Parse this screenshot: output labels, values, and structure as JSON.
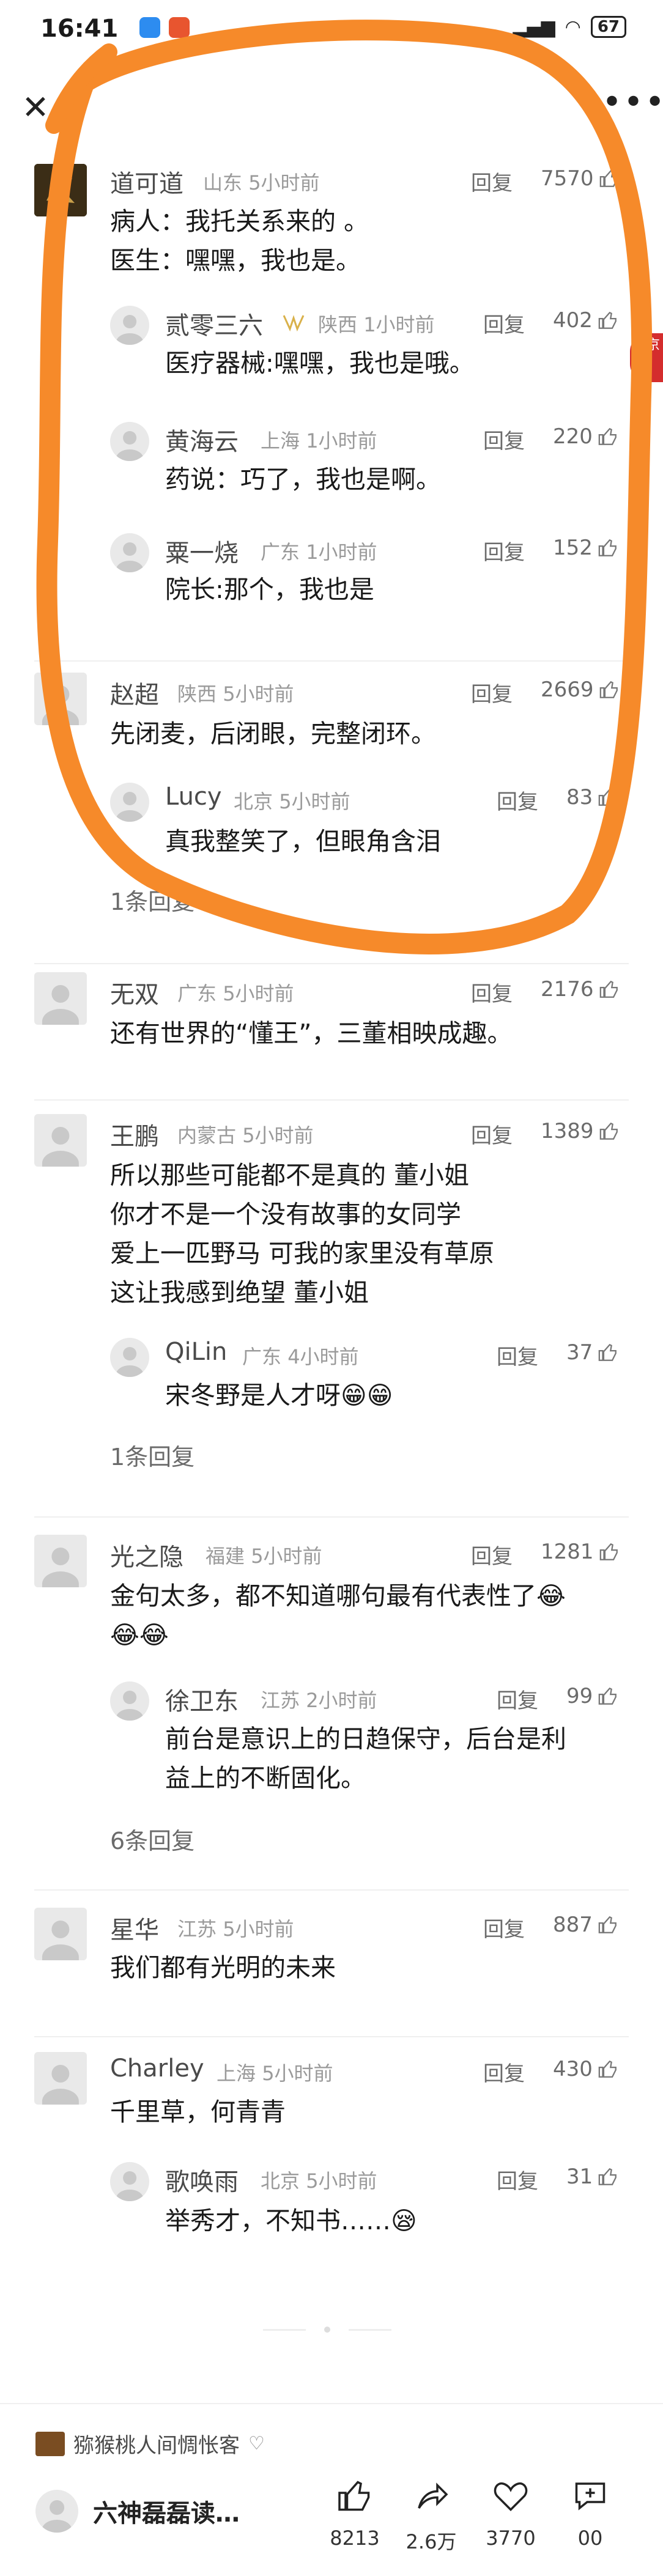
{
  "status_bar": {
    "time": "16:41",
    "battery": "67"
  },
  "toolbar": {
    "more_label": "•••"
  },
  "side_badge": "新京",
  "reply_label": "回复",
  "comments": [
    {
      "name": "道可道",
      "location": "山东",
      "time": "5小时前",
      "likes": "7570",
      "lines": [
        "病人：我托关系来的 。",
        "医生：嘿嘿，我也是。"
      ],
      "replies": [
        {
          "name": "贰零三六",
          "location": "陕西",
          "time": "1小时前",
          "likes": "402",
          "lines": [
            "医疗器械:嘿嘿，我也是哦。"
          ]
        },
        {
          "name": "黄海云",
          "location": "上海",
          "time": "1小时前",
          "likes": "220",
          "lines": [
            "药说：巧了，我也是啊。"
          ]
        },
        {
          "name": "粟一烧",
          "location": "广东",
          "time": "1小时前",
          "likes": "152",
          "lines": [
            "院长:那个，我也是"
          ]
        }
      ]
    },
    {
      "name": "赵超",
      "location": "陕西",
      "time": "5小时前",
      "likes": "2669",
      "lines": [
        "先闭麦，后闭眼，完整闭环。"
      ],
      "replies": [
        {
          "name": "Lucy",
          "location": "北京",
          "time": "5小时前",
          "likes": "83",
          "lines": [
            "真我整笑了，但眼角含泪"
          ]
        }
      ],
      "more": "1条回复"
    },
    {
      "name": "无双",
      "location": "广东",
      "time": "5小时前",
      "likes": "2176",
      "lines": [
        "还有世界的“懂王”，三董相映成趣。"
      ]
    },
    {
      "name": "王鹏",
      "location": "内蒙古",
      "time": "5小时前",
      "likes": "1389",
      "lines": [
        "所以那些可能都不是真的 董小姐",
        "你才不是一个没有故事的女同学",
        "爱上一匹野马 可我的家里没有草原",
        "这让我感到绝望 董小姐"
      ],
      "replies": [
        {
          "name": "QiLin",
          "location": "广东",
          "time": "4小时前",
          "likes": "37",
          "lines": [
            "宋冬野是人才呀😁😁"
          ]
        }
      ],
      "more": "1条回复"
    },
    {
      "name": "光之隐",
      "location": "福建",
      "time": "5小时前",
      "likes": "1281",
      "lines": [
        "金句太多，都不知道哪句最有代表性了😂",
        "😂😂"
      ],
      "replies": [
        {
          "name": "徐卫东",
          "location": "江苏",
          "time": "2小时前",
          "likes": "99",
          "lines": [
            "前台是意识上的日趋保守，后台是利",
            "益上的不断固化。"
          ]
        }
      ],
      "more": "6条回复"
    },
    {
      "name": "星华",
      "location": "江苏",
      "time": "5小时前",
      "likes": "887",
      "lines": [
        "我们都有光明的未来"
      ]
    },
    {
      "name": "Charley",
      "location": "上海",
      "time": "5小时前",
      "likes": "430",
      "lines": [
        "千里草，何青青"
      ],
      "replies": [
        {
          "name": "歌唤雨",
          "location": "北京",
          "time": "5小时前",
          "likes": "31",
          "lines": [
            "举秀才，不知书……😪"
          ]
        }
      ]
    }
  ],
  "bottom": {
    "author": "猕猴桃人间惆怅客",
    "input_placeholder": "六神磊磊读…",
    "like_count": "8213",
    "share_count": "2.6万",
    "fav_count": "3770",
    "comment_count": "00"
  },
  "colors": {
    "overlay": "#f68a2a",
    "text": "#1a1a1a",
    "muted": "#9a9a9a"
  }
}
